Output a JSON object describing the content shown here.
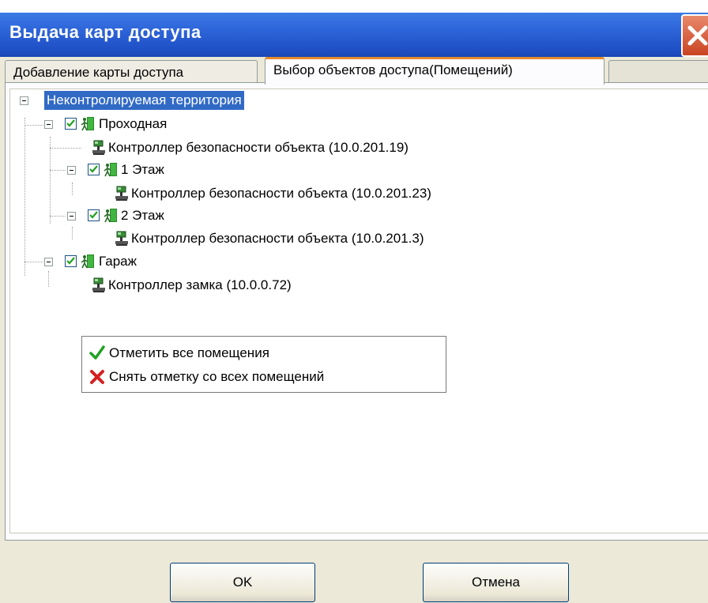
{
  "window": {
    "title": "Выдача карт доступа"
  },
  "tabs": [
    {
      "label": "Добавление карты доступа"
    },
    {
      "label": "Выбор объектов доступа(Помещений)"
    }
  ],
  "tree": {
    "root": "Неконтролируемая территория",
    "n1": "Проходная",
    "n1_ctrl": "Контроллер безопасности объекта (10.0.201.19)",
    "n2": "1 Этаж",
    "n2_ctrl": "Контроллер безопасности объекта (10.0.201.23)",
    "n3": "2 Этаж",
    "n3_ctrl": "Контроллер безопасности объекта (10.0.201.3)",
    "n4": "Гараж",
    "n4_ctrl": "Контроллер замка (10.0.0.72)"
  },
  "context_menu": {
    "check_all": "Отметить все помещения",
    "uncheck_all": "Снять отметку со всех помещений"
  },
  "buttons": {
    "ok": "OK",
    "cancel": "Отмена"
  },
  "colors": {
    "titlebar": "#2d63d8",
    "selection": "#316ac5",
    "check": "#21a121",
    "cross": "#d42020",
    "active_tab_accent": "#e68b2c"
  }
}
